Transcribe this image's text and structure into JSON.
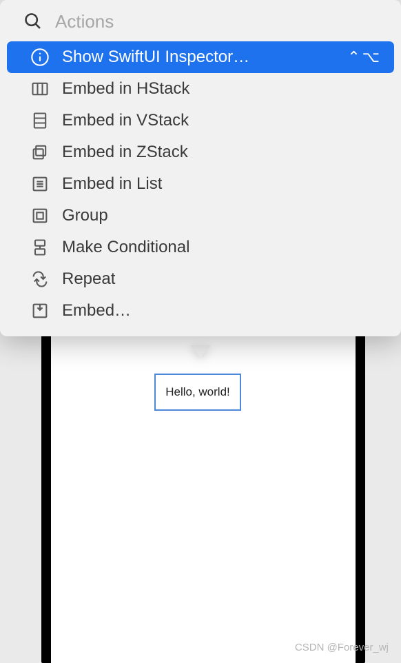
{
  "search": {
    "placeholder": "Actions",
    "value": ""
  },
  "menu": {
    "items": [
      {
        "label": "Show SwiftUI Inspector…",
        "shortcut": "⌃⌥",
        "selected": true,
        "icon": "info-icon"
      },
      {
        "label": "Embed in HStack",
        "shortcut": "",
        "selected": false,
        "icon": "hstack-icon"
      },
      {
        "label": "Embed in VStack",
        "shortcut": "",
        "selected": false,
        "icon": "vstack-icon"
      },
      {
        "label": "Embed in ZStack",
        "shortcut": "",
        "selected": false,
        "icon": "zstack-icon"
      },
      {
        "label": "Embed in List",
        "shortcut": "",
        "selected": false,
        "icon": "list-icon"
      },
      {
        "label": "Group",
        "shortcut": "",
        "selected": false,
        "icon": "group-icon"
      },
      {
        "label": "Make Conditional",
        "shortcut": "",
        "selected": false,
        "icon": "conditional-icon"
      },
      {
        "label": "Repeat",
        "shortcut": "",
        "selected": false,
        "icon": "repeat-icon"
      },
      {
        "label": "Embed…",
        "shortcut": "",
        "selected": false,
        "icon": "embed-icon"
      }
    ]
  },
  "preview": {
    "element_text": "Hello, world!"
  },
  "watermark": "CSDN @Forever_wj"
}
